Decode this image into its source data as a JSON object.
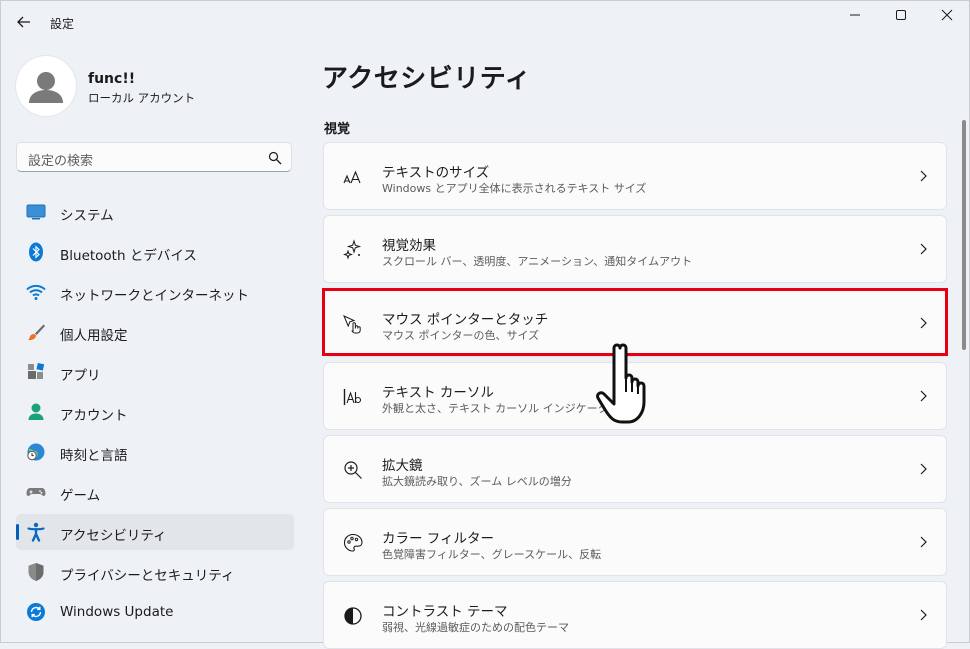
{
  "window": {
    "title": "設定"
  },
  "profile": {
    "name": "func!!",
    "account_type": "ローカル アカウント"
  },
  "search": {
    "placeholder": "設定の検索"
  },
  "nav": {
    "items": [
      {
        "label": "システム",
        "icon": "system-icon"
      },
      {
        "label": "Bluetooth とデバイス",
        "icon": "bluetooth-icon"
      },
      {
        "label": "ネットワークとインターネット",
        "icon": "wifi-icon"
      },
      {
        "label": "個人用設定",
        "icon": "paintbrush-icon"
      },
      {
        "label": "アプリ",
        "icon": "apps-icon"
      },
      {
        "label": "アカウント",
        "icon": "account-icon"
      },
      {
        "label": "時刻と言語",
        "icon": "time-language-icon"
      },
      {
        "label": "ゲーム",
        "icon": "gamepad-icon"
      },
      {
        "label": "アクセシビリティ",
        "icon": "accessibility-icon",
        "active": true
      },
      {
        "label": "プライバシーとセキュリティ",
        "icon": "shield-icon"
      },
      {
        "label": "Windows Update",
        "icon": "windows-update-icon"
      }
    ]
  },
  "main": {
    "title": "アクセシビリティ",
    "section": "視覚",
    "cards": [
      {
        "title": "テキストのサイズ",
        "subtitle": "Windows とアプリ全体に表示されるテキスト サイズ",
        "icon": "text-size-icon"
      },
      {
        "title": "視覚効果",
        "subtitle": "スクロール バー、透明度、アニメーション、通知タイムアウト",
        "icon": "sparkle-icon"
      },
      {
        "title": "マウス ポインターとタッチ",
        "subtitle": "マウス ポインターの色、サイズ",
        "icon": "mouse-pointer-touch-icon",
        "highlighted": true
      },
      {
        "title": "テキスト カーソル",
        "subtitle": "外観と太さ、テキスト カーソル インジケーター",
        "icon": "text-cursor-icon"
      },
      {
        "title": "拡大鏡",
        "subtitle": "拡大鏡読み取り、ズーム レベルの増分",
        "icon": "magnifier-icon"
      },
      {
        "title": "カラー フィルター",
        "subtitle": "色覚障害フィルター、グレースケール、反転",
        "icon": "palette-icon"
      },
      {
        "title": "コントラスト テーマ",
        "subtitle": "弱視、光線過敏症のための配色テーマ",
        "icon": "contrast-icon"
      }
    ]
  },
  "colors": {
    "accent": "#005fb8",
    "highlight": "#e60012",
    "background": "#eef1f5",
    "card": "#fbfbfc"
  }
}
